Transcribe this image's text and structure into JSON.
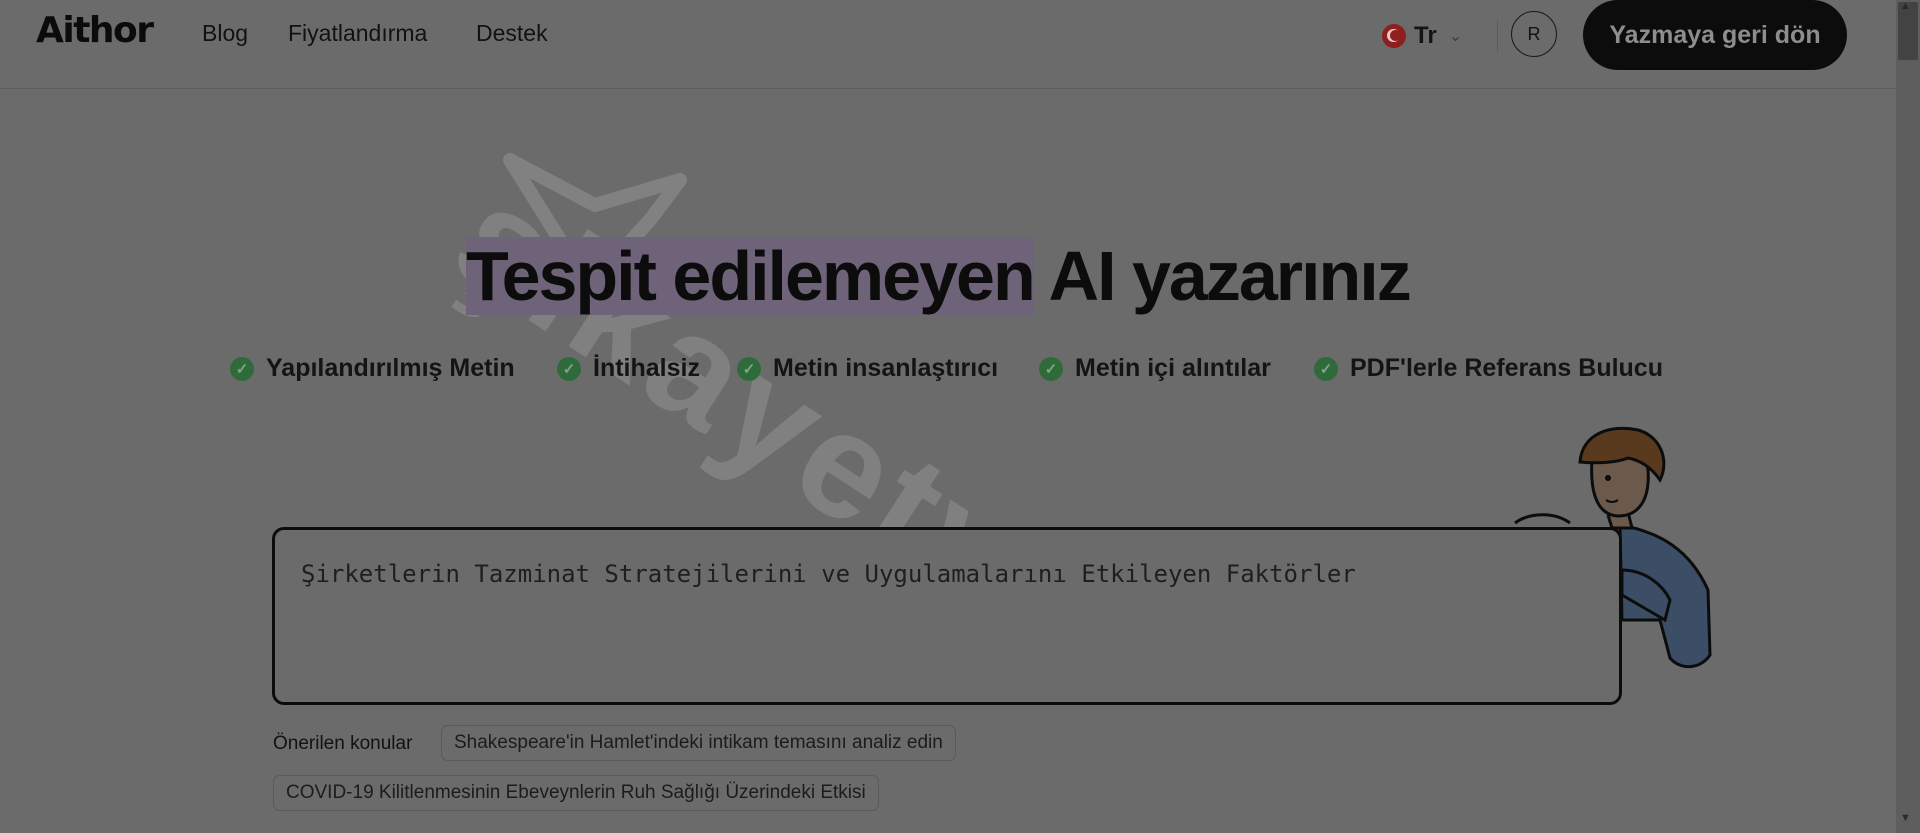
{
  "header": {
    "logo": "Aithor",
    "nav": [
      "Blog",
      "Fiyatlandırma",
      "Destek"
    ],
    "language": "Tr",
    "avatar_initial": "R",
    "cta_label": "Yazmaya geri dön"
  },
  "hero": {
    "title_highlight": "Tespit edilemeyen",
    "title_rest": " AI yazarınız"
  },
  "features": [
    "Yapılandırılmış Metin",
    "İntihalsiz",
    "Metin insanlaştırıcı",
    "Metin içi alıntılar",
    "PDF'lerle Referans Bulucu"
  ],
  "topic_input": {
    "value": "Şirketlerin Tazminat Stratejilerini ve Uygulamalarını Etkileyen Faktörler"
  },
  "suggestions": {
    "label": "Önerilen konular",
    "chips": [
      "Shakespeare'in Hamlet'indeki intikam temasını analiz edin",
      "COVID-19 Kilitlenmesinin Ebeveynlerin Ruh Sağlığı Üzerindeki Etkisi"
    ]
  },
  "watermark": "şikayetvar",
  "colors": {
    "overlay": "#6b6b6b",
    "cta_bg": "#0c0c0c",
    "check": "#2f6b3a",
    "highlight": "#6e6378"
  },
  "icons": {
    "check": "check-circle-icon",
    "flag": "turkey-flag-icon",
    "chevron": "chevron-down-icon"
  }
}
